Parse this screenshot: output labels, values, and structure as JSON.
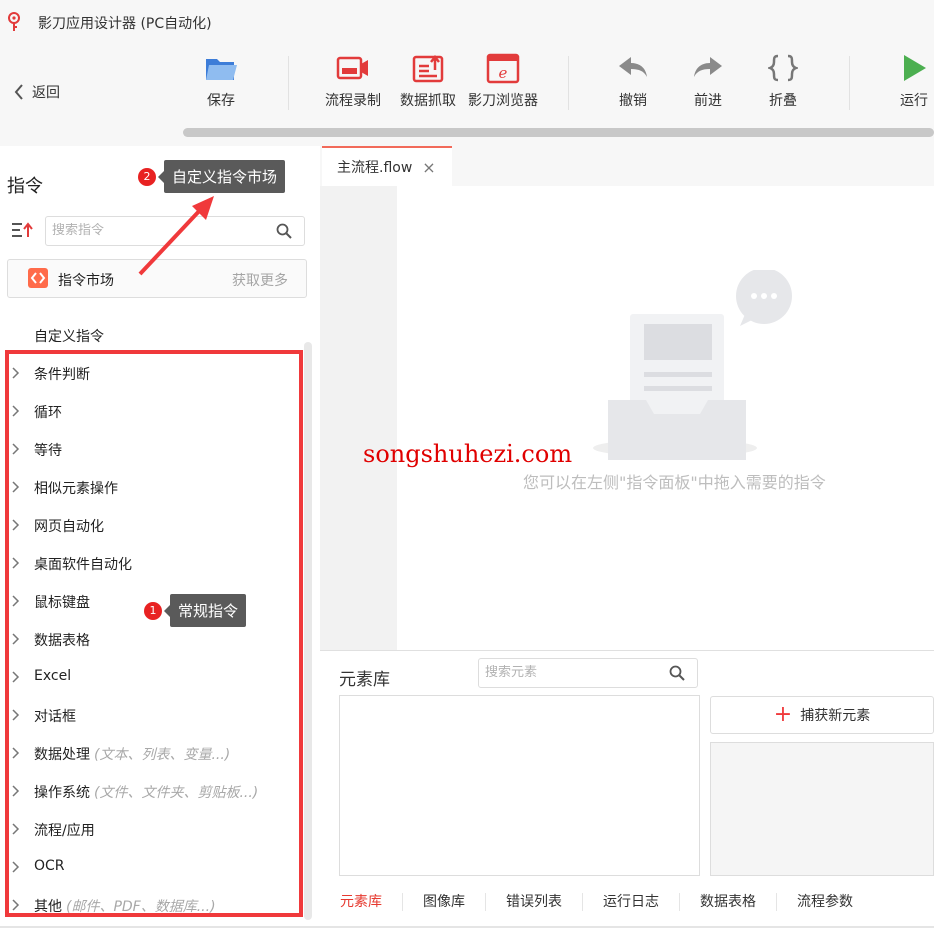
{
  "window": {
    "title": "影刀应用设计器 (PC自动化)"
  },
  "toolbar": {
    "back_label": "返回",
    "save_label": "保存",
    "record_label": "流程录制",
    "scrape_label": "数据抓取",
    "browser_label": "影刀浏览器",
    "undo_label": "撤销",
    "redo_label": "前进",
    "fold_label": "折叠",
    "run_label": "运行"
  },
  "left_panel": {
    "title": "指令",
    "search_placeholder": "搜索指令",
    "market_label": "指令市场",
    "market_more": "获取更多",
    "custom_label": "自定义指令",
    "commands": [
      {
        "label": "条件判断",
        "hint": ""
      },
      {
        "label": "循环",
        "hint": ""
      },
      {
        "label": "等待",
        "hint": ""
      },
      {
        "label": "相似元素操作",
        "hint": ""
      },
      {
        "label": "网页自动化",
        "hint": ""
      },
      {
        "label": "桌面软件自动化",
        "hint": ""
      },
      {
        "label": "鼠标键盘",
        "hint": ""
      },
      {
        "label": "数据表格",
        "hint": ""
      },
      {
        "label": "Excel",
        "hint": ""
      },
      {
        "label": "对话框",
        "hint": ""
      },
      {
        "label": "数据处理",
        "hint": "(文本、列表、变量...)"
      },
      {
        "label": "操作系统",
        "hint": "(文件、文件夹、剪贴板...)"
      },
      {
        "label": "流程/应用",
        "hint": ""
      },
      {
        "label": "OCR",
        "hint": ""
      },
      {
        "label": "其他",
        "hint": "(邮件、PDF、数据库...)"
      }
    ]
  },
  "editor": {
    "tab_label": "主流程.flow",
    "tab_close": "×",
    "empty_hint": "您可以在左侧\"指令面板\"中拖入需要的指令"
  },
  "watermark": "songshuhezi.com",
  "element_library": {
    "title": "元素库",
    "search_placeholder": "搜索元素",
    "capture_label": "捕获新元素",
    "capture_plus": "+"
  },
  "bottom_tabs": [
    "元素库",
    "图像库",
    "错误列表",
    "运行日志",
    "数据表格",
    "流程参数"
  ],
  "annotations": {
    "one_num": "1",
    "one_text": "常规指令",
    "two_num": "2",
    "two_text": "自定义指令市场"
  },
  "colors": {
    "accent": "#e6392f",
    "highlight_box": "#f0393b",
    "run_green": "#4caf50",
    "icon_blue": "#3d7dd8"
  }
}
